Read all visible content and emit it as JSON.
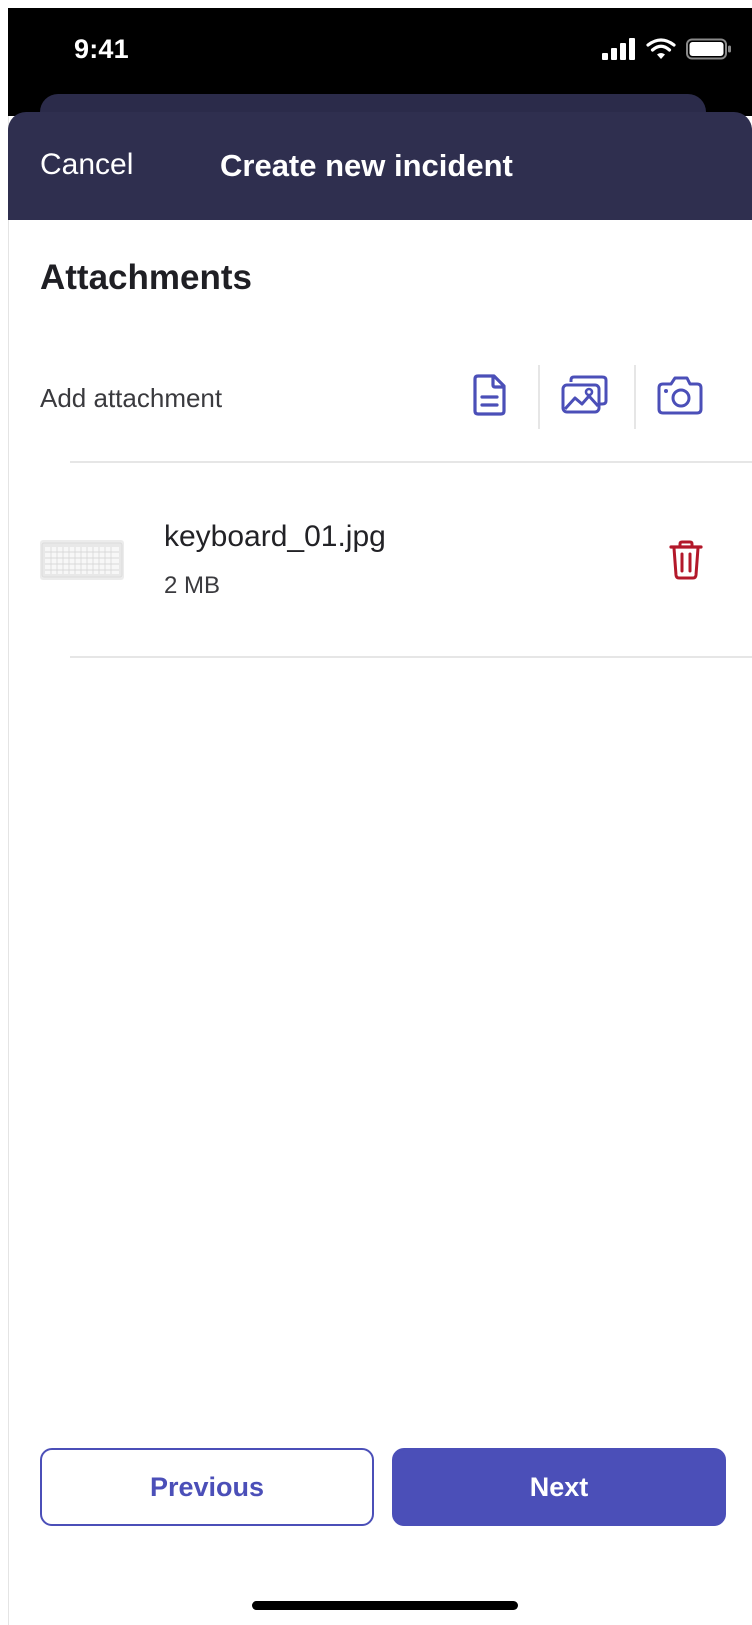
{
  "status_bar": {
    "time": "9:41"
  },
  "header": {
    "cancel_label": "Cancel",
    "title": "Create new incident"
  },
  "attachments": {
    "section_title": "Attachments",
    "add_label": "Add attachment",
    "actions": [
      {
        "icon": "document-icon"
      },
      {
        "icon": "image-gallery-icon"
      },
      {
        "icon": "camera-icon"
      }
    ]
  },
  "files": [
    {
      "name": "keyboard_01.jpg",
      "size": "2 MB",
      "thumbnail": "keyboard-thumbnail"
    }
  ],
  "footer": {
    "previous_label": "Previous",
    "next_label": "Next"
  },
  "colors": {
    "header_bg": "#2f2f4f",
    "accent": "#4b4fb8",
    "delete": "#b3182a"
  }
}
